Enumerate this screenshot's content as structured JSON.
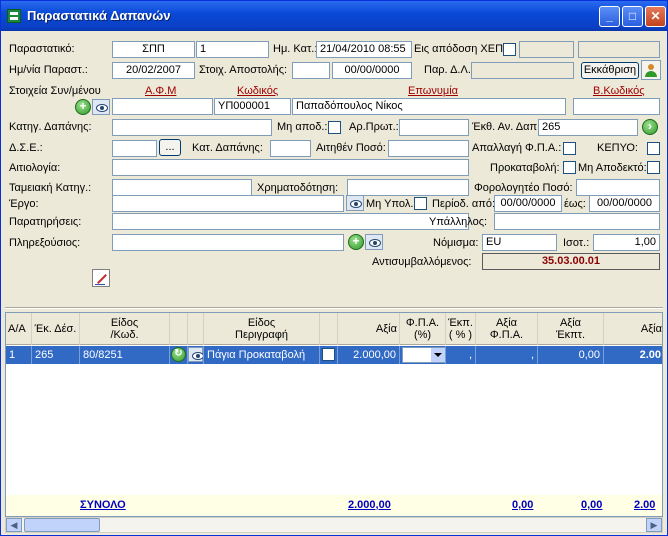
{
  "window": {
    "title": "Παραστατικά Δαπανών"
  },
  "form": {
    "parastatiko_label": "Παραστατικό:",
    "parastatiko_code": "ΣΠΠ",
    "parastatiko_num": "1",
    "hm_kat_label": "Ημ. Κατ.:",
    "hm_kat_value": "21/04/2010 08:55",
    "eis_apodosi_label": "Εις απόδοση ΧΕΠ",
    "hm_parast_label": "Ημ/νία Παραστ.:",
    "hm_parast_value": "20/02/2007",
    "stoix_apost_label": "Στοιχ. Αποστολής:",
    "stoix_apost_date": "00/00/0000",
    "par_dl_label": "Παρ. Δ.Λ.:",
    "ekkathrisi_label": "Εκκάθριση",
    "stoixeia_label": "Στοιχεία Συν/μένου",
    "afm_head": "Α.Φ.Μ",
    "kodikos_head": "Κωδικός",
    "eponymia_head": "Επωνυμία",
    "bkodikos_head": "Β.Κωδικός",
    "kodikos_value": "ΥΠ000001",
    "eponymia_value": "Παπαδόπουλος Νίκος",
    "katig_dapanis_label": "Κατηγ. Δαπάνης:",
    "mi_apod_label": "Μη αποδ.:",
    "ar_prot_label": "Αρ.Πρωτ.:",
    "ekth_an_dap_label": "Έκθ. Αν. Δαπ:",
    "ekth_an_dap_value": "265",
    "dse_label": "Δ.Σ.Ε.:",
    "dots_label": "...",
    "kat_dapanis_label": "Κατ. Δαπάνης:",
    "aitithen_poso_label": "Αιτηθέν Ποσό:",
    "apallagi_fpa_label": "Απαλλαγή Φ.Π.Α.:",
    "kepyo_label": "ΚΕΠΥΟ:",
    "aitiologia_label": "Αιτιολογία:",
    "prokatavoli_label": "Προκαταβολή:",
    "mi_apodekto_label": "Μη Αποδεκτό:",
    "tameiaki_katig_label": "Ταμειακή Κατηγ.:",
    "xrimatodotisi_label": "Χρηματοδότηση:",
    "forologiteo_label": "Φορολογητέο Ποσό:",
    "ergo_label": "Έργο:",
    "mi_ypol_label": "Μη Υπολ.:",
    "periodos_apo_label": "Περίοδ. από:",
    "periodos_apo_value": "00/00/0000",
    "eos_label": "έως:",
    "eos_value": "00/00/0000",
    "paratiriseis_label": "Παρατηρήσεις:",
    "ypallilos_label": "Υπάλληλος:",
    "plirexousios_label": "Πληρεξούσιος:",
    "nomisma_label": "Νόμισμα:",
    "nomisma_value": "EU",
    "isot_label": "Ισοτ.:",
    "isot_value": "1,00",
    "antisymv_label": "Αντισυμβαλλόμενος:",
    "antisymv_value": "35.03.00.01"
  },
  "grid": {
    "headers": [
      "Α/Α",
      "Έκ. Δέσ.",
      "Είδος\n/Κωδ.",
      "Είδος\nΠεριγραφή",
      "Αξία",
      "Φ.Π.Α.\n(%)",
      "Έκπ.\n( % )",
      "Αξία\nΦ.Π.Α.",
      "Αξία\nΈκπτ.",
      "Αξία"
    ],
    "row": {
      "aa": "1",
      "ek_des": "265",
      "eidos_kod": "80/8251",
      "perigrafi": "Πάγια Προκαταβολή",
      "axia": "2.000,00",
      "ekpt_pct": ",",
      "axia_fpa": ",",
      "axia_ekpt": "0,00",
      "axia2": "2.00"
    },
    "totals": {
      "label": "ΣΥΝΟΛΟ",
      "axia": "2.000,00",
      "fpa": "0,00",
      "ekpt": "0,00",
      "axia2": "2.00"
    }
  }
}
